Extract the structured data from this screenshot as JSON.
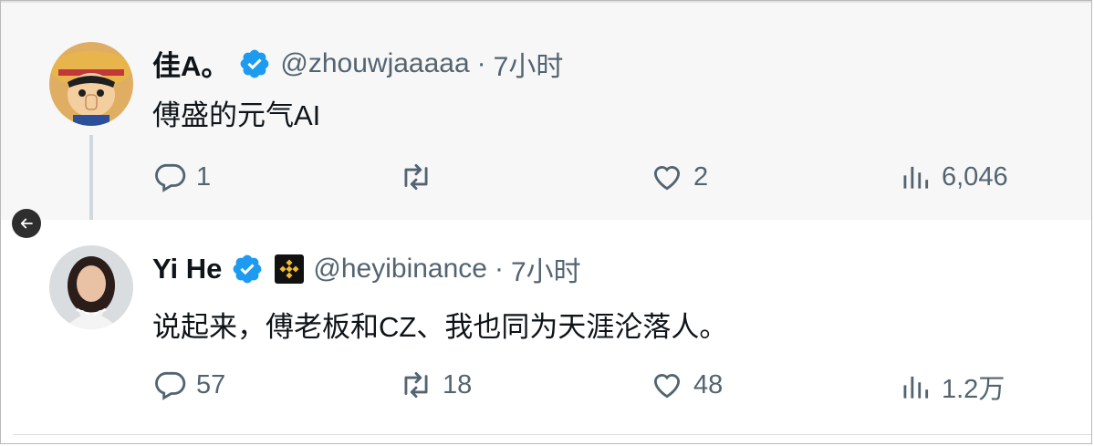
{
  "thread": {
    "reply": {
      "display_name": "佳A。",
      "handle": "@zhouwjaaaaa",
      "separator": "·",
      "time": "7小时",
      "text": "傅盛的元气AI",
      "replies": "1",
      "retweets": "",
      "likes": "2",
      "views": "6,046",
      "avatar_icon": "anime-boy-straw-hat-avatar"
    },
    "main": {
      "display_name": "Yi He",
      "handle": "@heyibinance",
      "separator": "·",
      "time": "7小时",
      "text": "说起来，傅老板和CZ、我也同为天涯沦落人。",
      "replies": "57",
      "retweets": "18",
      "likes": "48",
      "views": "1.2万",
      "avatar_icon": "woman-portrait-avatar",
      "affiliation_icon": "binance-logo-icon"
    }
  },
  "colors": {
    "verified_blue": "#1d9bf0",
    "binance_yellow": "#f3ba2f",
    "secondary_text": "#536471"
  }
}
